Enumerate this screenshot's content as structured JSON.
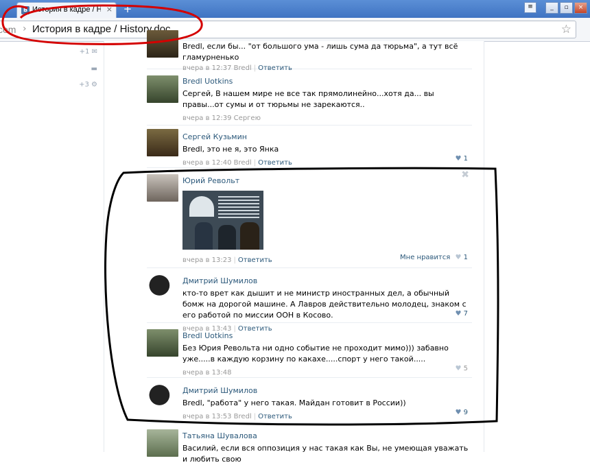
{
  "browser": {
    "tab_favicon": "В",
    "tab_title": "История в кадре / Histo",
    "tab_close": "×",
    "new_tab": "+",
    "menu_icon": "menu-icon",
    "win_buttons": [
      "_",
      "▫",
      "×"
    ],
    "url_domain": "com",
    "url_separator": "›",
    "url_path": "История в кадре / History.doc",
    "star": "☆"
  },
  "left_actions": {
    "mail_count": "+1",
    "settings_count": "+3"
  },
  "colors": {
    "link": "#2b587a",
    "annotation": "#d40000"
  },
  "comments": [
    {
      "author": "",
      "text": "Bredl, если бы... \"от большого ума - лишь сума да тюрьма\", а тут всё гламурненько",
      "time": "вчера в 12:37 Bredl",
      "reply": "Ответить",
      "likes_label": "",
      "likes": ""
    },
    {
      "author": "Bredl Uotkins",
      "text": "Сергей, В нашем мире не все так прямолинейно...хотя да... вы правы...от сумы и от тюрьмы не зарекаются..",
      "time": "вчера в 12:39 Сергею",
      "reply": "",
      "likes_label": "",
      "likes": ""
    },
    {
      "author": "Сергей Кузьмин",
      "text": "Bredl, это не я, это Янка",
      "time": "вчера в 12:40 Bredl",
      "reply": "Ответить",
      "likes_label": "",
      "likes": "1"
    },
    {
      "author": "Юрий Револьт",
      "text": "",
      "time": "вчера в 13:23",
      "reply": "Ответить",
      "likes_label": "Мне нравится",
      "likes": "1"
    },
    {
      "author": "Дмитрий Шумилов",
      "text": "кто-то врет как дышит и не министр иностранных дел, а обычный бомж на дорогой машине. А Лавров действительно молодец, знаком с его работой по миссии ООН в Косово.",
      "time": "вчера в 13:43",
      "reply": "Ответить",
      "likes_label": "",
      "likes": "7"
    },
    {
      "author": "Bredl Uotkins",
      "text": "Без Юрия Револьта ни одно событие не проходит мимо))) забавно уже.....в каждую корзину по какахе.....спорт у него такой.....",
      "time": "вчера в 13:48",
      "reply": "",
      "likes_label": "",
      "likes": "5"
    },
    {
      "author": "Дмитрий Шумилов",
      "text": "Bredl, \"работа\" у него такая. Майдан готовит в России))",
      "time": "вчера в 13:53 Bredl",
      "reply": "Ответить",
      "likes_label": "",
      "likes": "9"
    },
    {
      "author": "Татьяна Шувалова",
      "text": "Василий, если вся оппозиция у нас такая как Вы, не умеющая уважать и любить свою",
      "time": "",
      "reply": "",
      "likes_label": "",
      "likes": ""
    }
  ]
}
